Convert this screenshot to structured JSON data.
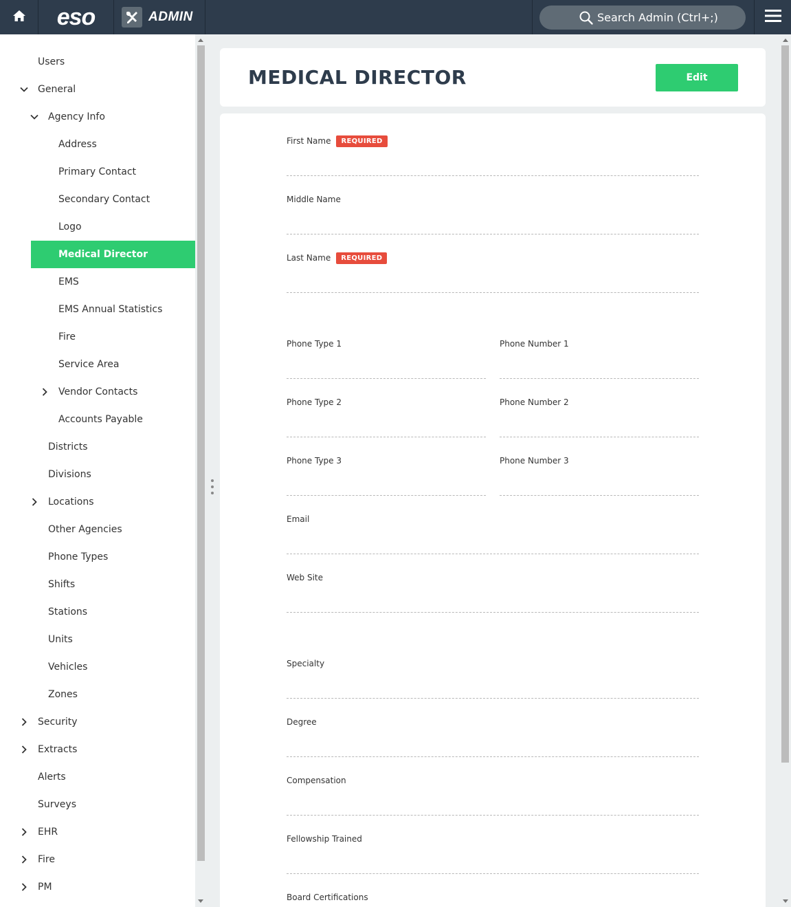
{
  "topbar": {
    "logo": "eso",
    "admin_label": "ADMIN",
    "search_placeholder": "Search Admin (Ctrl+;)"
  },
  "sidebar": {
    "items": [
      {
        "label": "Users",
        "indent": 0,
        "chevron": "none"
      },
      {
        "label": "General",
        "indent": 0,
        "chevron": "down"
      },
      {
        "label": "Agency Info",
        "indent": 1,
        "chevron": "down"
      },
      {
        "label": "Address",
        "indent": 2,
        "chevron": "none"
      },
      {
        "label": "Primary Contact",
        "indent": 2,
        "chevron": "none"
      },
      {
        "label": "Secondary Contact",
        "indent": 2,
        "chevron": "none"
      },
      {
        "label": "Logo",
        "indent": 2,
        "chevron": "none"
      },
      {
        "label": "Medical Director",
        "indent": 2,
        "chevron": "none",
        "active": true
      },
      {
        "label": "EMS",
        "indent": 2,
        "chevron": "none"
      },
      {
        "label": "EMS Annual Statistics",
        "indent": 2,
        "chevron": "none"
      },
      {
        "label": "Fire",
        "indent": 2,
        "chevron": "none"
      },
      {
        "label": "Service Area",
        "indent": 2,
        "chevron": "none"
      },
      {
        "label": "Vendor Contacts",
        "indent": 2,
        "chevron": "right"
      },
      {
        "label": "Accounts Payable",
        "indent": 2,
        "chevron": "none"
      },
      {
        "label": "Districts",
        "indent": 1,
        "chevron": "none"
      },
      {
        "label": "Divisions",
        "indent": 1,
        "chevron": "none"
      },
      {
        "label": "Locations",
        "indent": 1,
        "chevron": "right"
      },
      {
        "label": "Other Agencies",
        "indent": 1,
        "chevron": "none"
      },
      {
        "label": "Phone Types",
        "indent": 1,
        "chevron": "none"
      },
      {
        "label": "Shifts",
        "indent": 1,
        "chevron": "none"
      },
      {
        "label": "Stations",
        "indent": 1,
        "chevron": "none"
      },
      {
        "label": "Units",
        "indent": 1,
        "chevron": "none"
      },
      {
        "label": "Vehicles",
        "indent": 1,
        "chevron": "none"
      },
      {
        "label": "Zones",
        "indent": 1,
        "chevron": "none"
      },
      {
        "label": "Security",
        "indent": 0,
        "chevron": "right"
      },
      {
        "label": "Extracts",
        "indent": 0,
        "chevron": "right"
      },
      {
        "label": "Alerts",
        "indent": 0,
        "chevron": "none"
      },
      {
        "label": "Surveys",
        "indent": 0,
        "chevron": "none"
      },
      {
        "label": "EHR",
        "indent": 0,
        "chevron": "right"
      },
      {
        "label": "Fire",
        "indent": 0,
        "chevron": "right"
      },
      {
        "label": "PM",
        "indent": 0,
        "chevron": "right"
      }
    ]
  },
  "main": {
    "title": "MEDICAL DIRECTOR",
    "edit_label": "Edit",
    "required_label": "REQUIRED",
    "fields": [
      {
        "label": "First Name",
        "required": true
      },
      {
        "label": "Middle Name",
        "required": false
      },
      {
        "label": "Last Name",
        "required": true
      },
      {
        "label": "Phone Type 1",
        "required": false
      },
      {
        "label": "Phone Number 1",
        "required": false
      },
      {
        "label": "Phone Type 2",
        "required": false
      },
      {
        "label": "Phone Number 2",
        "required": false
      },
      {
        "label": "Phone Type 3",
        "required": false
      },
      {
        "label": "Phone Number 3",
        "required": false
      },
      {
        "label": "Email",
        "required": false
      },
      {
        "label": "Web Site",
        "required": false
      },
      {
        "label": "Specialty",
        "required": false
      },
      {
        "label": "Degree",
        "required": false
      },
      {
        "label": "Compensation",
        "required": false
      },
      {
        "label": "Fellowship Trained",
        "required": false
      },
      {
        "label": "Board Certifications",
        "required": false
      }
    ]
  },
  "colors": {
    "topbar": "#2e3c4c",
    "accent": "#2ecc71",
    "required": "#e74c3c"
  },
  "icons": {
    "home": "home-icon",
    "admin": "tools-icon",
    "search": "search-icon",
    "menu": "hamburger-menu-icon"
  }
}
